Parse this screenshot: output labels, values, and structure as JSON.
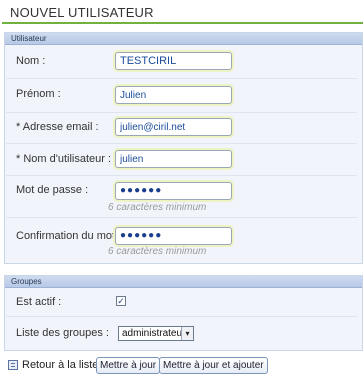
{
  "page": {
    "title": "NOUVEL UTILISATEUR"
  },
  "user_section": {
    "header": "Utilisateur",
    "fields": {
      "nom": {
        "label": "Nom :",
        "value": "TESTCIRIL"
      },
      "prenom": {
        "label": "Prénom :",
        "value": "Julien"
      },
      "email": {
        "label": "* Adresse email :",
        "value": "julien@ciril.net"
      },
      "username": {
        "label": "* Nom d'utilisateur :",
        "value": "julien"
      },
      "password": {
        "label": "Mot de passe :",
        "value": "●●●●●●",
        "hint": "6 caractères minimum"
      },
      "confirm": {
        "label": "Confirmation du mot",
        "value": "●●●●●●",
        "hint": "6 caractères minimum"
      }
    }
  },
  "groups_section": {
    "header": "Groupes",
    "active": {
      "label": "Est actif :",
      "checked": true,
      "mark": "✓"
    },
    "groups": {
      "label": "Liste des groupes :",
      "selected": "administrateur",
      "arrow": "▾"
    }
  },
  "footer": {
    "back_link": "Retour à la liste",
    "update_button": "Mettre à jour",
    "update_add_button": "Mettre à jour et ajouter"
  }
}
